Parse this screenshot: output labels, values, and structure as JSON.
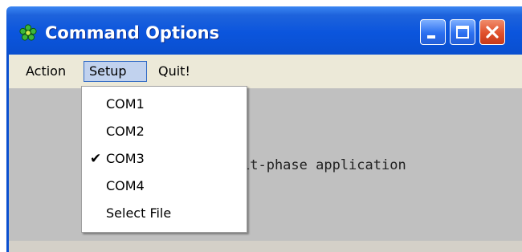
{
  "window": {
    "title": "Command Options",
    "icon": "green-flower-icon"
  },
  "titlebar_buttons": {
    "minimize": "minimize-icon",
    "maximize": "maximize-icon",
    "close": "close-icon"
  },
  "menubar": {
    "items": [
      {
        "label": "Action"
      },
      {
        "label": "Setup",
        "open": true
      },
      {
        "label": "Quit!"
      }
    ]
  },
  "setup_menu": {
    "items": [
      {
        "label": "COM1",
        "checked": false
      },
      {
        "label": "COM2",
        "checked": false
      },
      {
        "label": "COM3",
        "checked": true
      },
      {
        "label": "COM4",
        "checked": false
      },
      {
        "label": "Select File",
        "checked": false
      }
    ],
    "check_glyph": "✔"
  },
  "client": {
    "text": "it-phase application"
  },
  "colors": {
    "titlebar": "#0a4fcf",
    "menubar": "#ece9d8",
    "client": "#c0c0c0",
    "menu_highlight": "#c1d2ee",
    "close_button": "#e0502c"
  }
}
